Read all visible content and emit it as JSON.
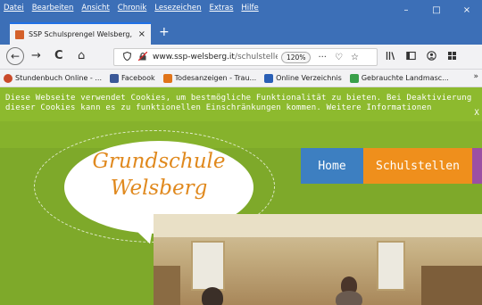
{
  "menubar": {
    "items": [
      "Datei",
      "Bearbeiten",
      "Ansicht",
      "Chronik",
      "Lesezeichen",
      "Extras",
      "Hilfe"
    ]
  },
  "window_controls": {
    "minimize": "–",
    "maximize": "□",
    "close": "×"
  },
  "tab": {
    "title": "SSP Schulsprengel Welsberg, G",
    "close": "×",
    "new_tab": "+"
  },
  "navbar": {
    "back": "←",
    "forward": "→",
    "reload": "C",
    "home": "⌂",
    "url_host": "www.ssp-welsberg.it",
    "url_path": "/schulstelle",
    "zoom": "120%",
    "page_actions": "···",
    "pocket": "♡",
    "bookmark_star": "☆"
  },
  "bookmarks": [
    {
      "label": "Stundenbuch Online - ...",
      "color": "#c94a2a"
    },
    {
      "label": "Facebook",
      "color": "#3b5998"
    },
    {
      "label": "Todesanzeigen - Trau...",
      "color": "#e0741a"
    },
    {
      "label": "Online Verzeichnis",
      "color": "#2a5fb5"
    },
    {
      "label": "Gebrauchte Landmasc...",
      "color": "#3aa04a"
    }
  ],
  "cookie_banner": {
    "line1": "Diese Webseite verwendet Cookies, um bestmögliche Funktionalität zu bieten. Bei Deaktivierung",
    "line2": "dieser Cookies kann es zu funktionellen Einschränkungen kommen. Weitere Informationen",
    "close": "X"
  },
  "site": {
    "logo_line1": "Grundschule",
    "logo_line2": "Welsberg",
    "nav": [
      {
        "label": "Home",
        "color": "#3d7fc1"
      },
      {
        "label": "Schulstellen",
        "color": "#ef8f1c"
      },
      {
        "label": "",
        "color": "#9c4fa3"
      }
    ]
  },
  "colors": {
    "titlebar": "#3c6fb7",
    "site_green": "#82ad2b",
    "logo_orange": "#e0891e"
  }
}
